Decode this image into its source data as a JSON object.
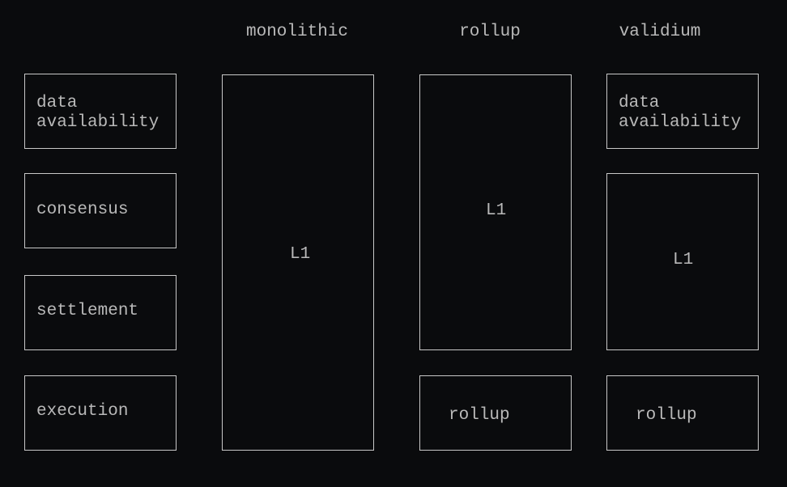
{
  "columns": {
    "monolithic": "monolithic",
    "rollup": "rollup",
    "validium": "validium"
  },
  "layers": {
    "data_availability": "data\navailability",
    "consensus": "consensus",
    "settlement": "settlement",
    "execution": "execution"
  },
  "monolithic": {
    "l1": "L1"
  },
  "rollup": {
    "l1": "L1",
    "rollup": "rollup"
  },
  "validium": {
    "da": "data\navailability",
    "l1": "L1",
    "rollup": "rollup"
  }
}
